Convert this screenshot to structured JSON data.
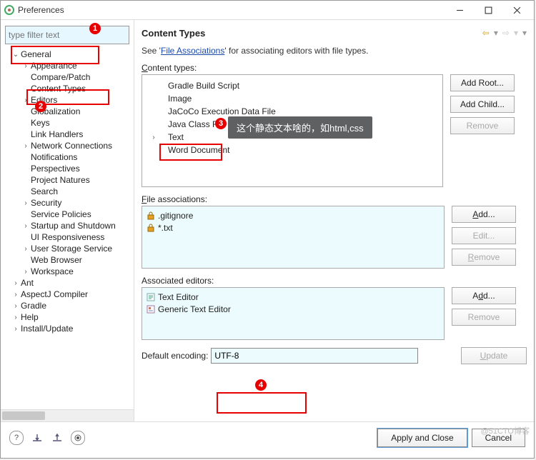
{
  "window": {
    "title": "Preferences"
  },
  "filter_placeholder": "type filter text",
  "tree": [
    {
      "lvl": 0,
      "exp": "open",
      "label": "General"
    },
    {
      "lvl": 1,
      "exp": "closed",
      "label": "Appearance"
    },
    {
      "lvl": 1,
      "exp": "none",
      "label": "Compare/Patch"
    },
    {
      "lvl": 1,
      "exp": "none",
      "label": "Content Types"
    },
    {
      "lvl": 1,
      "exp": "closed",
      "label": "Editors"
    },
    {
      "lvl": 1,
      "exp": "none",
      "label": "Globalization"
    },
    {
      "lvl": 1,
      "exp": "none",
      "label": "Keys"
    },
    {
      "lvl": 1,
      "exp": "none",
      "label": "Link Handlers"
    },
    {
      "lvl": 1,
      "exp": "closed",
      "label": "Network Connections"
    },
    {
      "lvl": 1,
      "exp": "none",
      "label": "Notifications"
    },
    {
      "lvl": 1,
      "exp": "none",
      "label": "Perspectives"
    },
    {
      "lvl": 1,
      "exp": "none",
      "label": "Project Natures"
    },
    {
      "lvl": 1,
      "exp": "none",
      "label": "Search"
    },
    {
      "lvl": 1,
      "exp": "closed",
      "label": "Security"
    },
    {
      "lvl": 1,
      "exp": "none",
      "label": "Service Policies"
    },
    {
      "lvl": 1,
      "exp": "closed",
      "label": "Startup and Shutdown"
    },
    {
      "lvl": 1,
      "exp": "none",
      "label": "UI Responsiveness"
    },
    {
      "lvl": 1,
      "exp": "closed",
      "label": "User Storage Service"
    },
    {
      "lvl": 1,
      "exp": "none",
      "label": "Web Browser"
    },
    {
      "lvl": 1,
      "exp": "closed",
      "label": "Workspace"
    },
    {
      "lvl": 0,
      "exp": "closed",
      "label": "Ant"
    },
    {
      "lvl": 0,
      "exp": "closed",
      "label": "AspectJ Compiler"
    },
    {
      "lvl": 0,
      "exp": "closed",
      "label": "Gradle"
    },
    {
      "lvl": 0,
      "exp": "closed",
      "label": "Help"
    },
    {
      "lvl": 0,
      "exp": "closed",
      "label": "Install/Update"
    }
  ],
  "main": {
    "title": "Content Types",
    "see_pre": "See '",
    "see_link": "File Associations",
    "see_post": "' for associating editors with file types.",
    "content_types_label": "Content types:",
    "content_types": [
      {
        "label": "Gradle Build Script",
        "exp": "none"
      },
      {
        "label": "Image",
        "exp": "none"
      },
      {
        "label": "JaCoCo Execution Data File",
        "exp": "none"
      },
      {
        "label": "Java Class File",
        "exp": "none"
      },
      {
        "label": "Text",
        "exp": "closed"
      },
      {
        "label": "Word Document",
        "exp": "none"
      }
    ],
    "file_assoc_label": "File associations:",
    "file_assoc": [
      ".gitignore",
      "*.txt"
    ],
    "assoc_editors_label": "Associated editors:",
    "assoc_editors": [
      "Text Editor",
      "Generic Text Editor"
    ],
    "encoding_label": "Default encoding:",
    "encoding_value": "UTF-8"
  },
  "buttons": {
    "add_root": "Add Root...",
    "add_child": "Add Child...",
    "remove": "Remove",
    "add": "Add...",
    "edit": "Edit...",
    "update": "Update",
    "apply": "Apply and Close",
    "cancel": "Cancel"
  },
  "annotation": {
    "tooltip": "这个静态文本啥的，如html,css",
    "n1": "1",
    "n2": "2",
    "n3": "3",
    "n4": "4"
  },
  "watermark": "@51CTO博客"
}
